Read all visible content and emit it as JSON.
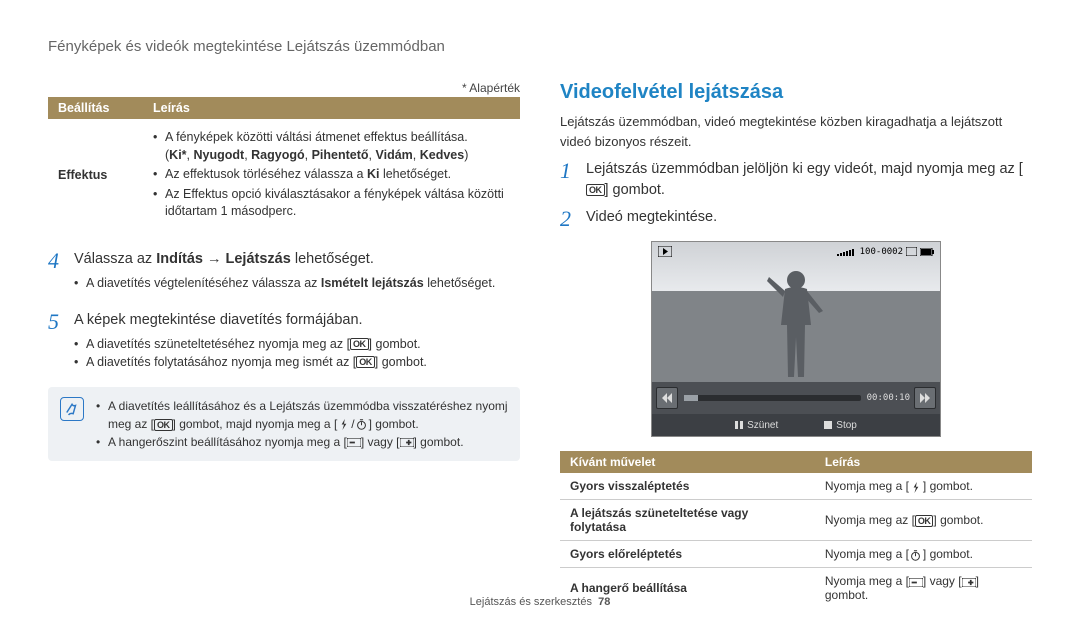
{
  "header": {
    "title": "Fényképek és videók megtekintése Lejátszás üzemmódban"
  },
  "left": {
    "default_note": "* Alapérték",
    "table": {
      "h1": "Beállítás",
      "h2": "Leírás",
      "r1_label": "Effektus",
      "r1_b1": "A fényképek közötti váltási átmenet effektus beállítása.",
      "r1_b1_bold": "(Ki*, Nyugodt, Ragyogó, Pihentető, Vidám, Kedves)",
      "r1_b2a": "Az effektusok törléséhez válassza a ",
      "r1_b2b": "Ki",
      "r1_b2c": " lehetőséget.",
      "r1_b3": "Az Effektus opció kiválasztásakor a fényképek váltása közötti időtartam 1 másodperc."
    },
    "step4": {
      "num": "4",
      "pre": "Válassza az ",
      "b1": "Indítás",
      "arrow": " → ",
      "b2": "Lejátszás",
      "post": " lehetőséget.",
      "sub1a": "A diavetítés végtelenítéséhez válassza az ",
      "sub1b": "Ismételt lejátszás",
      "sub1c": " lehetőséget."
    },
    "step5": {
      "num": "5",
      "line": "A képek megtekintése diavetítés formájában.",
      "s1a": "A diavetítés szüneteltetéséhez nyomja meg az [",
      "s1b": "] gombot.",
      "s2a": "A diavetítés folytatásához nyomja meg ismét az [",
      "s2b": "] gombot."
    },
    "note": {
      "l1a": "A diavetítés leállításához és a Lejátszás üzemmódba visszatéréshez nyomj meg az [",
      "l1b": "] gombot, majd nyomja meg a [",
      "l1c": "] gombot.",
      "l2a": "A hangerőszint beállításához nyomja meg a [",
      "l2mid": "] vagy [",
      "l2b": "] gombot."
    }
  },
  "right": {
    "title": "Videofelvétel lejátszása",
    "intro": "Lejátszás üzemmódban, videó megtekintése közben kiragadhatja a lejátszott videó bizonyos részeit.",
    "step1_num": "1",
    "step1a": "Lejátszás üzemmódban jelöljön ki egy videót, majd nyomja meg az [",
    "step1b": "] gombot.",
    "step2_num": "2",
    "step2": "Videó megtekintése.",
    "screen": {
      "counter": "100-0002",
      "time": "00:00:10",
      "pause": "Szünet",
      "stop": "Stop"
    },
    "table": {
      "h1": "Kívánt művelet",
      "h2": "Leírás",
      "r1a": "Gyors visszaléptetés",
      "r1b1": "Nyomja meg a [",
      "r1b2": "] gombot.",
      "r2a": "A lejátszás szüneteltetése vagy folytatása",
      "r2b1": "Nyomja meg az [",
      "r2b2": "] gombot.",
      "r3a": "Gyors előreléptetés",
      "r3b1": "Nyomja meg a [",
      "r3b2": "] gombot.",
      "r4a": "A hangerő beállítása",
      "r4b1": "Nyomja meg a [",
      "r4bmid": "] vagy [",
      "r4b2": "] gombot."
    }
  },
  "footer": {
    "text": "Lejátszás és szerkesztés",
    "page": "78"
  }
}
